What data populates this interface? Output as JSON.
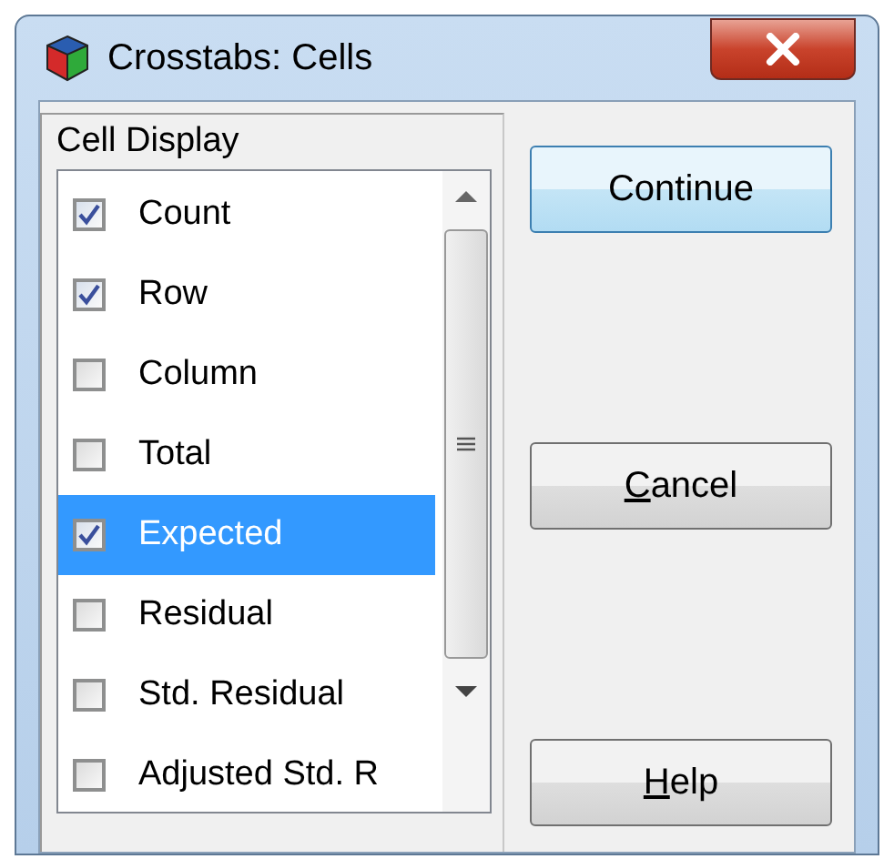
{
  "window": {
    "title": "Crosstabs: Cells"
  },
  "group": {
    "title": "Cell Display",
    "items": [
      {
        "label": "Count",
        "checked": true,
        "selected": false
      },
      {
        "label": "Row",
        "checked": true,
        "selected": false
      },
      {
        "label": "Column",
        "checked": false,
        "selected": false
      },
      {
        "label": "Total",
        "checked": false,
        "selected": false
      },
      {
        "label": "Expected",
        "checked": true,
        "selected": true
      },
      {
        "label": "Residual",
        "checked": false,
        "selected": false
      },
      {
        "label": "Std. Residual",
        "checked": false,
        "selected": false
      },
      {
        "label": "Adjusted Std. R",
        "checked": false,
        "selected": false
      }
    ]
  },
  "buttons": [
    {
      "label": "Continue",
      "kind": "default"
    },
    {
      "mnemonic": "C",
      "label_rest": "ancel",
      "kind": "normal"
    },
    {
      "mnemonic": "H",
      "label_rest": "elp",
      "kind": "normal"
    }
  ]
}
